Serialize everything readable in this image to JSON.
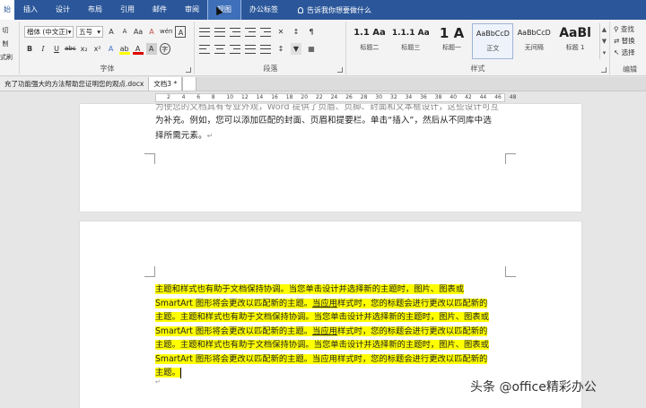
{
  "ribbon_tabs": [
    "始",
    "插入",
    "设计",
    "布局",
    "引用",
    "邮件",
    "审阅",
    "视图",
    "办公标签"
  ],
  "tell_me": "告诉我你想要做什么",
  "font_group": {
    "font_name": "楷体 (中文正)",
    "font_size": "五号",
    "grow": "A",
    "shrink": "A",
    "case": "Aa",
    "clear": "A",
    "pinyin": "wén",
    "border_char": "A",
    "bold": "B",
    "italic": "I",
    "underline": "U",
    "strike": "abc",
    "subscript": "x₂",
    "superscript": "x²",
    "effects": "A",
    "highlight": "ab",
    "font_color": "A",
    "shading": "A",
    "circle": "字",
    "label": "字体"
  },
  "left_clip": [
    "切",
    "制",
    "式刷"
  ],
  "paragraph_label": "段落",
  "styles": [
    {
      "sample": "1.1  Aa",
      "name": "标题二"
    },
    {
      "sample": "1.1.1  Aa",
      "name": "标题三"
    },
    {
      "sample": "1  A",
      "name": "标题一"
    },
    {
      "sample": "AaBbCcD",
      "name": "正文"
    },
    {
      "sample": "AaBbCcD",
      "name": "无间隔"
    },
    {
      "sample": "AaBl",
      "name": "标题 1"
    }
  ],
  "styles_label": "样式",
  "editing": [
    "查找",
    "替换",
    "选择"
  ],
  "editing_label": "编辑",
  "doc_tabs": [
    "充了功能强大的方法帮助您证明您的观点.docx",
    "文档3 *"
  ],
  "ruler_numbers": [
    "2",
    "4",
    "6",
    "8",
    "10",
    "12",
    "14",
    "16",
    "18",
    "20",
    "22",
    "24",
    "26",
    "28",
    "30",
    "32",
    "34",
    "36",
    "38",
    "40",
    "42",
    "44",
    "46",
    "48"
  ],
  "page1_lines": [
    "为使您的文档具有专业外观，Word 提供了页眉、页脚、封面和文本框设计，这些设计可互",
    "为补充。例如，您可以添加匹配的封面、页眉和提要栏。单击“插入”，然后从不同库中选",
    "择所需元素。"
  ],
  "page2_lines": [
    "主题和样式也有助于文档保持协调。当您单击设计并选择新的主题时，图片、图表或",
    "SmartArt 图形将会更改以匹配新的主题。|当应用|样式时，您的标题会进行更改以匹配新的",
    "主题。主题和样式也有助于文档保持协调。当您单击设计并选择新的主题时，图片、图表或",
    "SmartArt 图形将会更改以匹配新的主题。|当应用|样式时，您的标题会进行更改以匹配新的",
    "主题。主题和样式也有助于文档保持协调。当您单击设计并选择新的主题时，图片、图表或",
    "SmartArt 图形将会更改以匹配新的主题。当应用样式时，您的标题会进行更改以匹配新的",
    "主题。"
  ],
  "paragraph_mark": "↵",
  "watermark": "头条 @office精彩办公",
  "colors": {
    "ribbon_blue": "#2b579a",
    "highlight": "#ffff00"
  }
}
